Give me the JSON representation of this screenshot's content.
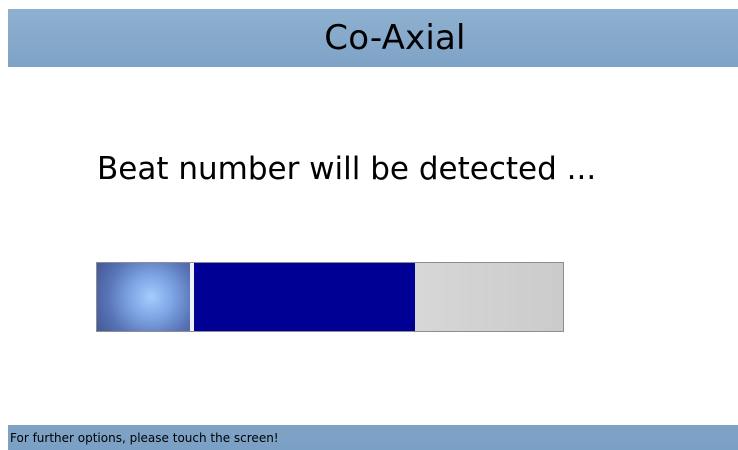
{
  "window": {
    "title": "Co-Axial"
  },
  "main": {
    "message": "Beat number will be detected ..."
  },
  "progress": {
    "fraction": 0.6,
    "fill_color": "#000094",
    "track_color": "#d5d5d5"
  },
  "footer": {
    "hint": "For further options, please touch the screen!"
  },
  "colors": {
    "accent_bar": "#86a9cb",
    "background": "#ffffff"
  }
}
